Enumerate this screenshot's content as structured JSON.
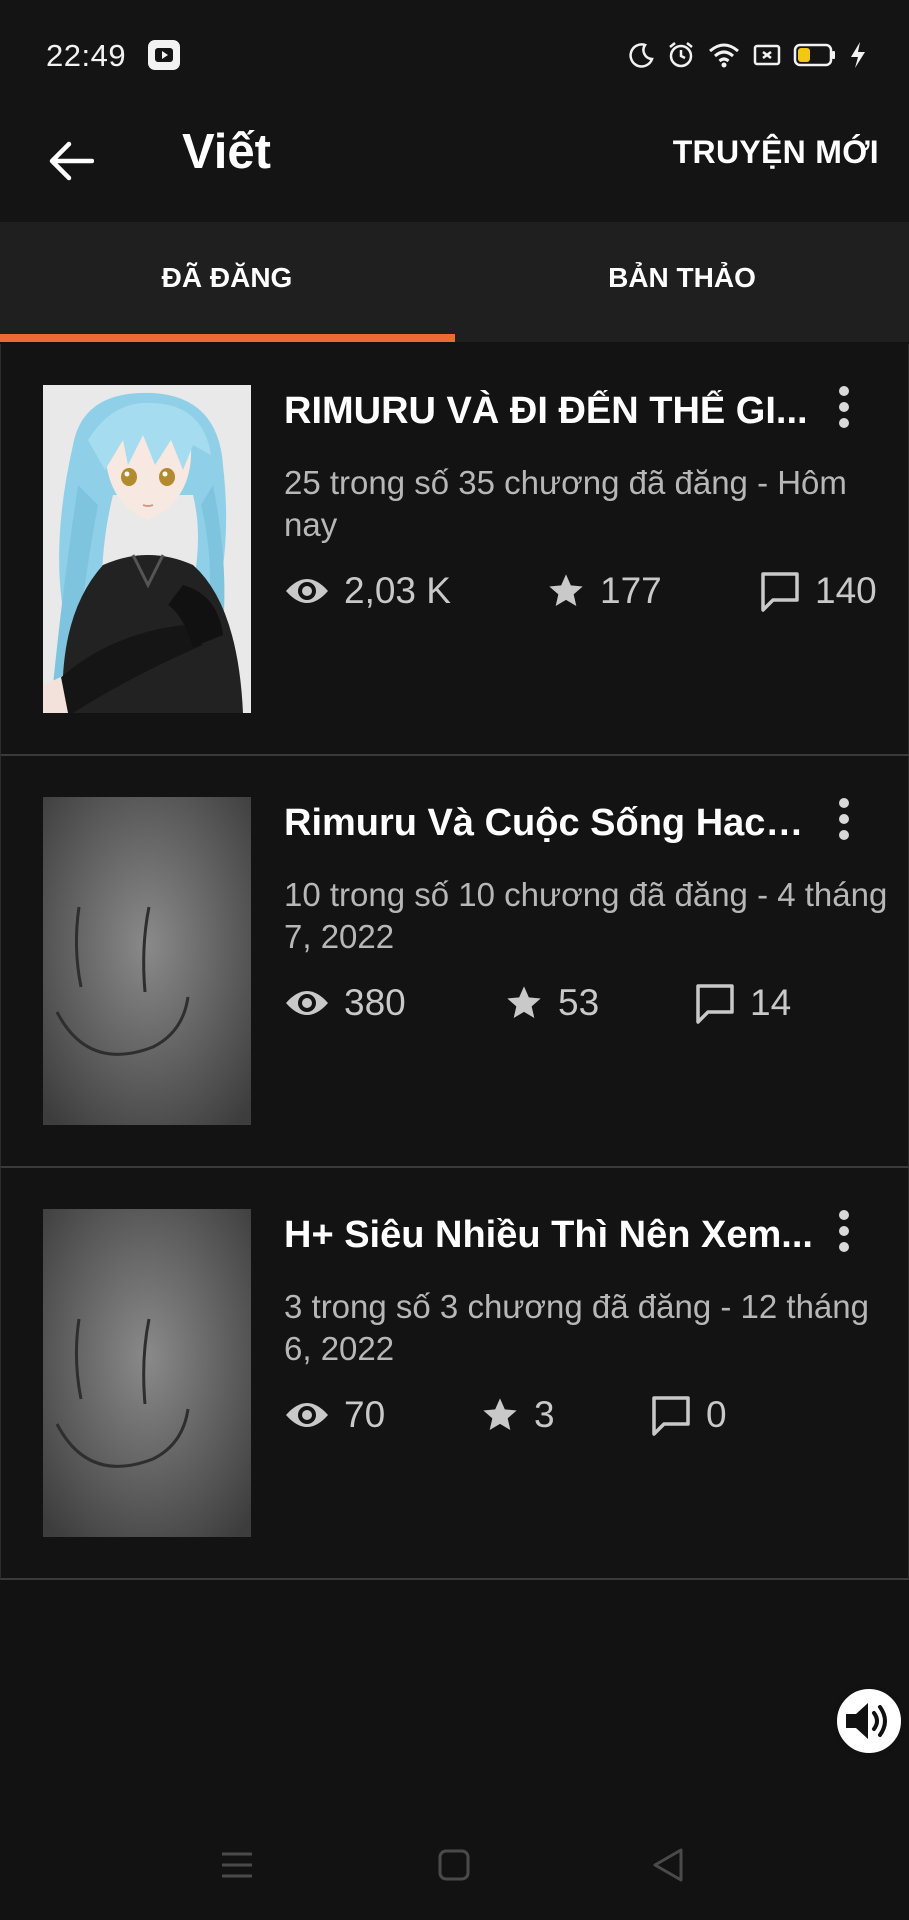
{
  "status_bar": {
    "time": "22:49",
    "icons": [
      "video-notification-icon",
      "moon-icon",
      "alarm-icon",
      "wifi-icon",
      "cast-icon",
      "battery-icon",
      "charging-icon"
    ],
    "battery_color": "#f2c811"
  },
  "app_bar": {
    "title": "Viết",
    "new_story_label": "TRUYỆN MỚI"
  },
  "tabs": [
    {
      "label": "ĐÃ ĐĂNG",
      "active": true
    },
    {
      "label": "BẢN THẢO",
      "active": false
    }
  ],
  "accent_color": "#ec6a33",
  "stories": [
    {
      "title": "RIMURU VÀ ĐI ĐẾN THẾ GI...",
      "meta": "25 trong số 35 chương đã đăng - Hôm nay",
      "views": "2,03 K",
      "votes": "177",
      "comments": "140",
      "cover": "anime-character-cover"
    },
    {
      "title": "Rimuru Và Cuộc Sống Hack...",
      "meta": "10 trong số 10 chương đã đăng - 4 tháng 7, 2022",
      "views": "380",
      "votes": "53",
      "comments": "14",
      "cover": "smiley-sketch-cover"
    },
    {
      "title": "H+ Siêu Nhiều Thì Nên Xem...",
      "meta": "3 trong số 3 chương đã đăng - 12 tháng 6, 2022",
      "views": "70",
      "votes": "3",
      "comments": "0",
      "cover": "smiley-sketch-cover"
    }
  ]
}
